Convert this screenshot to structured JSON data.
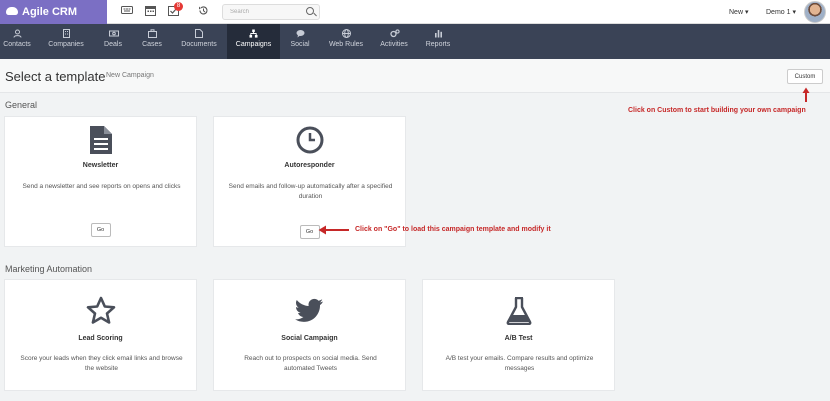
{
  "app": {
    "brand": "Agile CRM"
  },
  "topbar": {
    "notification_count": "8",
    "search_placeholder": "Search",
    "new_label": "New ▾",
    "user_label": "Demo 1 ▾"
  },
  "nav": {
    "items": [
      {
        "label": "Contacts",
        "icon": "user-icon"
      },
      {
        "label": "Companies",
        "icon": "building-icon"
      },
      {
        "label": "Deals",
        "icon": "money-icon"
      },
      {
        "label": "Cases",
        "icon": "briefcase-icon"
      },
      {
        "label": "Documents",
        "icon": "document-icon"
      },
      {
        "label": "Campaigns",
        "icon": "sitemap-icon",
        "active": true
      },
      {
        "label": "Social",
        "icon": "chat-icon"
      },
      {
        "label": "Web Rules",
        "icon": "globe-icon"
      },
      {
        "label": "Activities",
        "icon": "cogs-icon"
      },
      {
        "label": "Reports",
        "icon": "bar-chart-icon"
      }
    ]
  },
  "page": {
    "title": "Select a template",
    "subtitle": "New Campaign",
    "custom_label": "Custom"
  },
  "sections": {
    "general": "General",
    "marketing": "Marketing Automation"
  },
  "cards": {
    "newsletter": {
      "title": "Newsletter",
      "desc": "Send a newsletter and see reports on opens and clicks",
      "go": "Go",
      "icon": "document-icon"
    },
    "autoresponder": {
      "title": "Autoresponder",
      "desc": "Send emails and follow-up automatically after a specified duration",
      "go": "Go",
      "icon": "clock-icon"
    },
    "lead_scoring": {
      "title": "Lead Scoring",
      "desc": "Score your leads when they click email links and browse the website",
      "icon": "star-icon"
    },
    "social_campaign": {
      "title": "Social Campaign",
      "desc": "Reach out to prospects on social media. Send automated Tweets",
      "icon": "twitter-bird-icon"
    },
    "ab_test": {
      "title": "A/B Test",
      "desc": "A/B test your emails. Compare results and optimize messages",
      "icon": "flask-icon"
    }
  },
  "annotations": {
    "custom_hint": "Click on Custom to start building your own campaign",
    "go_hint": "Click on \"Go\" to load this campaign template and modify it"
  },
  "colors": {
    "brand": "#7b6fc4",
    "nav_bg": "#3a4356",
    "nav_active": "#252c3a",
    "annotation": "#c62828"
  }
}
